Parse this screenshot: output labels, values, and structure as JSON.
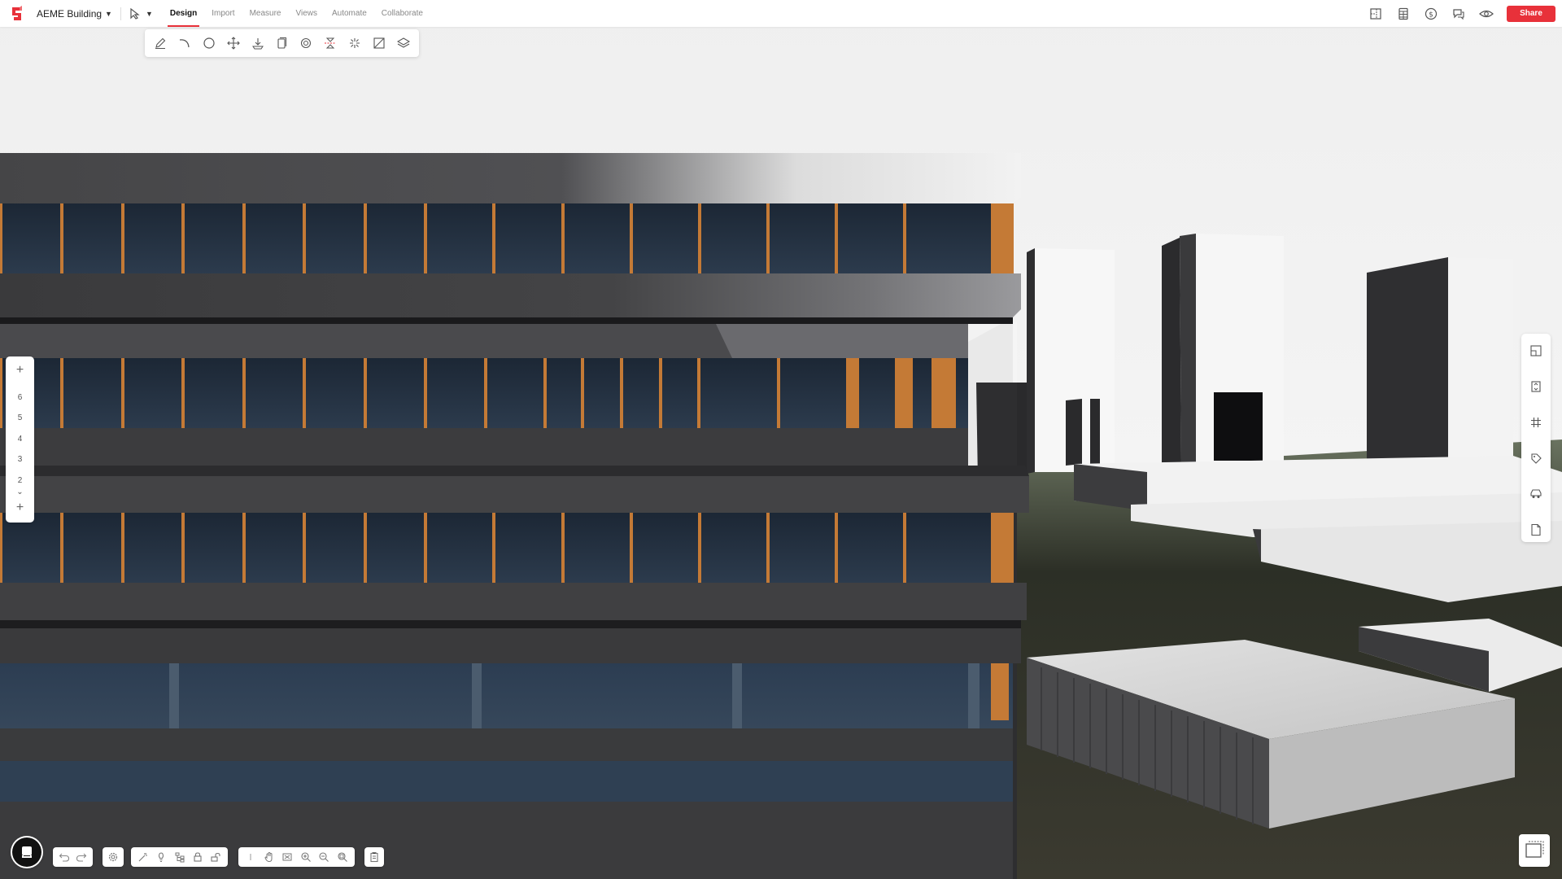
{
  "app": {
    "project_name": "AEME Building"
  },
  "tabs": [
    {
      "label": "Design",
      "active": true
    },
    {
      "label": "Import",
      "active": false
    },
    {
      "label": "Measure",
      "active": false
    },
    {
      "label": "Views",
      "active": false
    },
    {
      "label": "Automate",
      "active": false
    },
    {
      "label": "Collaborate",
      "active": false
    }
  ],
  "header_icons": [
    "floorplan-icon",
    "spreadsheet-icon",
    "dollar-icon",
    "comments-icon",
    "eye-icon"
  ],
  "share_label": "Share",
  "drawing_tools": [
    "pencil-icon",
    "arc-icon",
    "circle-icon",
    "move-icon",
    "extrude-icon",
    "copy-icon",
    "rotate-icon",
    "mirror-icon",
    "explode-icon",
    "slope-icon",
    "layers-icon"
  ],
  "levels": {
    "items": [
      "6",
      "5",
      "4",
      "3",
      "2"
    ]
  },
  "right_panel_icons": [
    "room-icon",
    "elevator-icon",
    "grid-icon",
    "tag-icon",
    "car-icon",
    "document-icon"
  ],
  "bottom_toolbar": {
    "history": [
      "undo-icon",
      "redo-icon"
    ],
    "settings": [
      "settings-icon"
    ],
    "edit_tools": [
      "magic-wand-icon",
      "bulb-icon",
      "tree-icon",
      "lock-icon",
      "unlock-icon"
    ],
    "view_tools": [
      "cursor-icon",
      "pan-icon",
      "fit-view-icon",
      "zoom-in-icon",
      "zoom-out-icon",
      "zoom-extents-icon"
    ],
    "misc": [
      "clipboard-icon"
    ]
  },
  "colors": {
    "accent": "#e8313a",
    "facade_dark": "#3e3d3e",
    "glass": "#233140",
    "mullion": "#c47a36"
  }
}
